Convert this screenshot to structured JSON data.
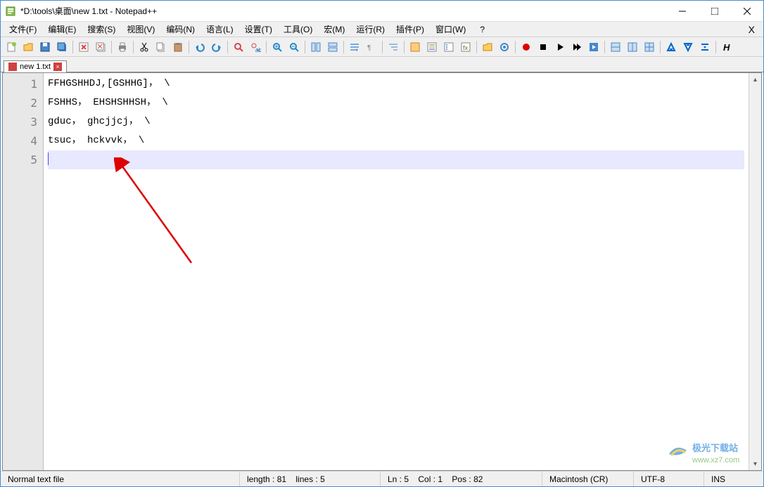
{
  "window": {
    "title": "*D:\\tools\\桌面\\new 1.txt - Notepad++"
  },
  "menu": {
    "items": [
      "文件(F)",
      "编辑(E)",
      "搜索(S)",
      "视图(V)",
      "编码(N)",
      "语言(L)",
      "设置(T)",
      "工具(O)",
      "宏(M)",
      "运行(R)",
      "插件(P)",
      "窗口(W)",
      "?"
    ]
  },
  "tabs": [
    {
      "label": "new 1.txt"
    }
  ],
  "editor": {
    "lines": [
      "FFHGSHHDJ,[GSHHG]， \\",
      "FSHHS， EHSHSHHSH， \\",
      "gduc， ghcjjcj， \\",
      "tsuc， hckvvk， \\",
      ""
    ],
    "current_line": 5
  },
  "status": {
    "filetype": "Normal text file",
    "length_label": "length : 81",
    "lines_label": "lines : 5",
    "ln_label": "Ln : 5",
    "col_label": "Col : 1",
    "pos_label": "Pos : 82",
    "eol": "Macintosh (CR)",
    "encoding": "UTF-8",
    "ins": "INS"
  },
  "icons": {
    "toolbar": [
      "new-file",
      "open-file",
      "save-file",
      "save-all",
      "sep",
      "close-file",
      "close-all",
      "sep",
      "print",
      "sep",
      "cut",
      "copy",
      "paste",
      "sep",
      "undo",
      "redo",
      "sep",
      "find",
      "replace",
      "sep",
      "zoom-in",
      "zoom-out",
      "sep",
      "sync-v",
      "sync-h",
      "sep",
      "word-wrap",
      "show-all",
      "sep",
      "indent-guide",
      "sep",
      "lang-user",
      "doc-map",
      "doc-list",
      "func-list",
      "sep",
      "folder",
      "monitor",
      "sep",
      "record",
      "stop",
      "play",
      "play-multi",
      "save-macro",
      "sep",
      "compare1",
      "compare2",
      "compare3",
      "sep",
      "spell1",
      "spell2",
      "spell3",
      "sep",
      "h-icon"
    ]
  },
  "watermark": {
    "text1": "极光下载站",
    "text2": "www.xz7.com"
  }
}
